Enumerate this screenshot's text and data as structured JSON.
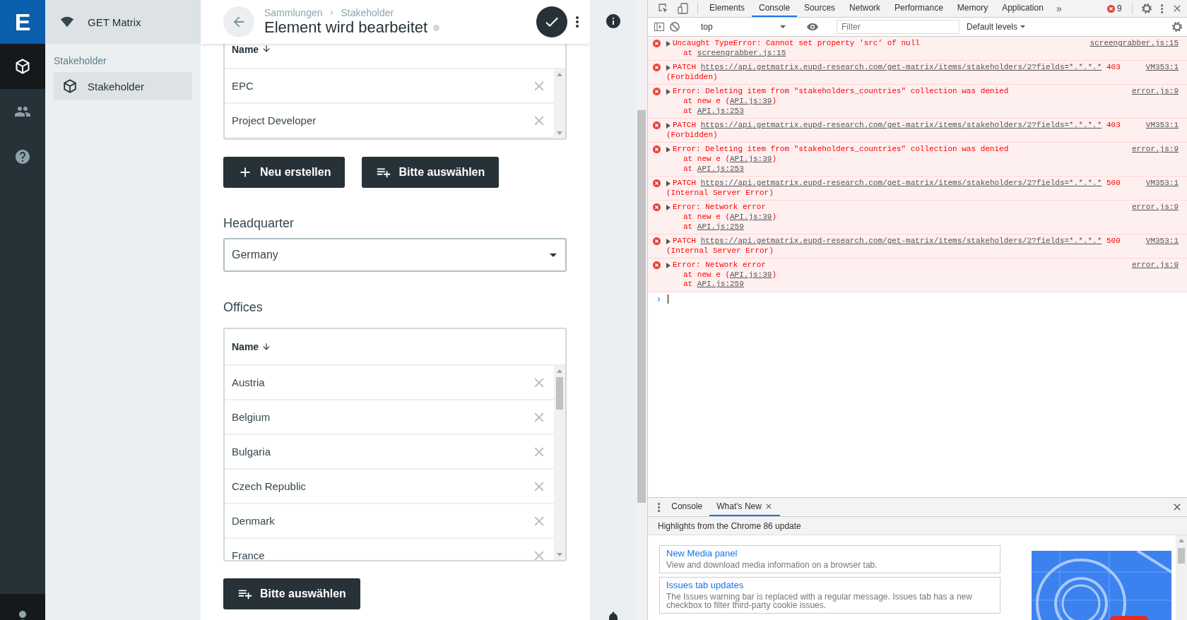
{
  "rail": {
    "logo": "E",
    "items": [
      {
        "selected": true
      },
      {
        "selected": false
      },
      {
        "selected": false
      }
    ]
  },
  "project": {
    "name": "GET Matrix"
  },
  "nav": {
    "section": "Stakeholder",
    "items": [
      {
        "label": "Stakeholder",
        "selected": true
      }
    ]
  },
  "header": {
    "breadcrumbs": [
      "Sammlungen",
      "Stakeholder"
    ],
    "title": "Element wird bearbeitet"
  },
  "stakeholder_types": {
    "column": "Name",
    "rows": [
      "EPC",
      "Project Developer"
    ],
    "buttons": [
      {
        "kind": "create",
        "label": "Neu erstellen"
      },
      {
        "kind": "select",
        "label": "Bitte auswählen"
      }
    ]
  },
  "headquarter": {
    "label": "Headquarter",
    "value": "Germany"
  },
  "offices": {
    "label": "Offices",
    "column": "Name",
    "rows": [
      "Austria",
      "Belgium",
      "Bulgaria",
      "Czech Republic",
      "Denmark",
      "France"
    ],
    "buttons": [
      {
        "kind": "select",
        "label": "Bitte auswählen"
      }
    ]
  },
  "devtools": {
    "tabs": [
      {
        "label": "Elements",
        "selected": false
      },
      {
        "label": "Console",
        "selected": true
      },
      {
        "label": "Sources",
        "selected": false
      },
      {
        "label": "Network",
        "selected": false
      },
      {
        "label": "Performance",
        "selected": false
      },
      {
        "label": "Memory",
        "selected": false
      },
      {
        "label": "Application",
        "selected": false
      }
    ],
    "overflow": "»",
    "error_count": "9",
    "context": "top",
    "filter_placeholder": "Filter",
    "levels": "Default levels",
    "messages": [
      {
        "kind": "exception",
        "text": "Uncaught TypeError: Cannot set property 'src' of null",
        "source": "screengrabber.js:15",
        "stack": [
          {
            "before": "at ",
            "link": "screengrabber.js:15"
          }
        ]
      },
      {
        "kind": "request",
        "method": "PATCH",
        "url": "https://api.getmatrix.eupd-research.com/get-matrix/items/stakeholders/2?fields=*.*.*.*",
        "status": "403",
        "reason": "(Forbidden)",
        "source": "VM353:1"
      },
      {
        "kind": "exception",
        "text": "Error: Deleting item from \"stakeholders_countries\" collection was denied",
        "source": "error.js:9",
        "stack": [
          {
            "before": "at new e (",
            "link": "API.js:39",
            "after": ")"
          },
          {
            "before": "at ",
            "link": "API.js:253"
          }
        ]
      },
      {
        "kind": "request",
        "method": "PATCH",
        "url": "https://api.getmatrix.eupd-research.com/get-matrix/items/stakeholders/2?fields=*.*.*.*",
        "status": "403",
        "reason": "(Forbidden)",
        "source": "VM353:1"
      },
      {
        "kind": "exception",
        "text": "Error: Deleting item from \"stakeholders_countries\" collection was denied",
        "source": "error.js:9",
        "stack": [
          {
            "before": "at new e (",
            "link": "API.js:39",
            "after": ")"
          },
          {
            "before": "at ",
            "link": "API.js:253"
          }
        ]
      },
      {
        "kind": "request",
        "method": "PATCH",
        "url": "https://api.getmatrix.eupd-research.com/get-matrix/items/stakeholders/2?fields=*.*.*.*",
        "status": "500",
        "reason": "(Internal Server Error)",
        "source": "VM353:1"
      },
      {
        "kind": "exception",
        "text": "Error: Network error",
        "source": "error.js:9",
        "stack": [
          {
            "before": "at new e (",
            "link": "API.js:39",
            "after": ")"
          },
          {
            "before": "at ",
            "link": "API.js:259"
          }
        ]
      },
      {
        "kind": "request",
        "method": "PATCH",
        "url": "https://api.getmatrix.eupd-research.com/get-matrix/items/stakeholders/2?fields=*.*.*.*",
        "status": "500",
        "reason": "(Internal Server Error)",
        "source": "VM353:1"
      },
      {
        "kind": "exception",
        "text": "Error: Network error",
        "source": "error.js:9",
        "stack": [
          {
            "before": "at new e (",
            "link": "API.js:39",
            "after": ")"
          },
          {
            "before": "at ",
            "link": "API.js:259"
          }
        ]
      }
    ],
    "drawer": {
      "tabs": [
        {
          "label": "Console",
          "selected": false,
          "closable": false
        },
        {
          "label": "What's New",
          "selected": true,
          "closable": true
        }
      ],
      "headline": "Highlights from the Chrome 86 update",
      "cards": [
        {
          "title": "New Media panel",
          "text": "View and download media information on a browser tab."
        },
        {
          "title": "Issues tab updates",
          "text": "The Issues warning bar is replaced with a regular message. Issues tab has a new checkbox to filter third-party cookie issues."
        }
      ]
    }
  }
}
